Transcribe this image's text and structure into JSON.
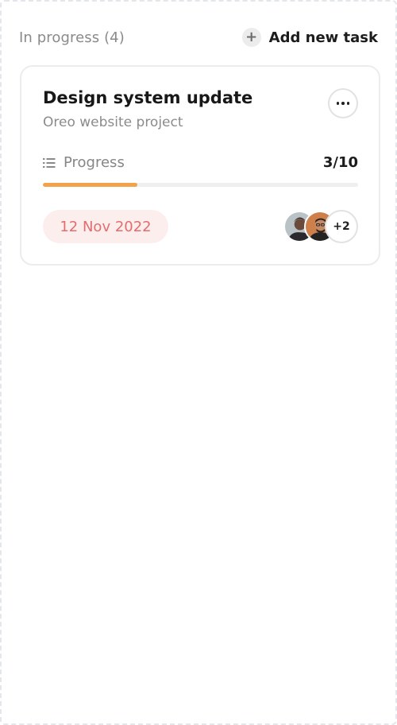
{
  "column": {
    "title": "In progress (4)",
    "add_label": "Add new task",
    "add_icon": "plus-icon"
  },
  "card": {
    "title": "Design system update",
    "subtitle": "Oreo website project",
    "more_icon": "more-horizontal-icon",
    "progress": {
      "icon": "list-icon",
      "label": "Progress",
      "count": "3/10",
      "fraction": 0.3,
      "color": "#f3a14a"
    },
    "date": "12 Nov 2022",
    "date_colors": {
      "text": "#e26d6d",
      "background": "#fdeeee"
    },
    "assignees": {
      "extra_count": "+2"
    }
  }
}
